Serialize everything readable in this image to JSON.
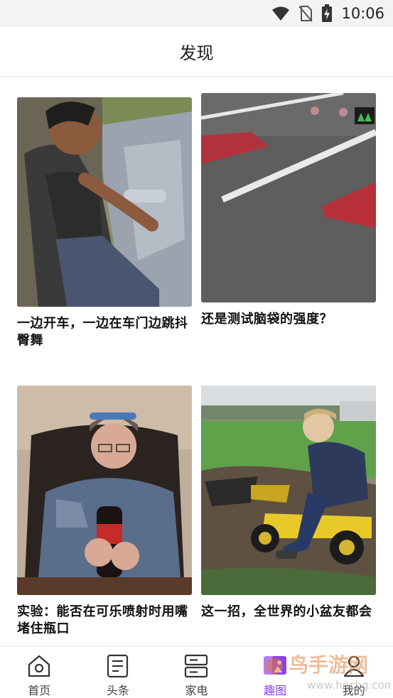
{
  "status_bar": {
    "time": "10:06",
    "icons": [
      "wifi-icon",
      "no-sim-icon",
      "battery-charging-icon"
    ]
  },
  "header": {
    "title": "发现"
  },
  "feed": {
    "items": [
      {
        "caption": "一边开车，一边在车门边跳抖臀舞"
      },
      {
        "caption": "还是测试脑袋的强度？"
      },
      {
        "caption": "实验：能否在可乐喷射时用嘴堵住瓶口"
      },
      {
        "caption": "这一招，全世界的小盆友都会"
      }
    ]
  },
  "tabbar": {
    "active_tab": "趣图",
    "accent_color": "#8a3ff0",
    "tabs": [
      {
        "label": "首页",
        "icon": "home-icon"
      },
      {
        "label": "头条",
        "icon": "news-icon"
      },
      {
        "label": "家电",
        "icon": "appliance-icon"
      },
      {
        "label": "趣图",
        "icon": "fun-pic-icon"
      },
      {
        "label": "我的",
        "icon": "profile-icon"
      }
    ]
  },
  "watermark": {
    "text": "鸟手游网",
    "url_text": "www.hnchg.com"
  }
}
